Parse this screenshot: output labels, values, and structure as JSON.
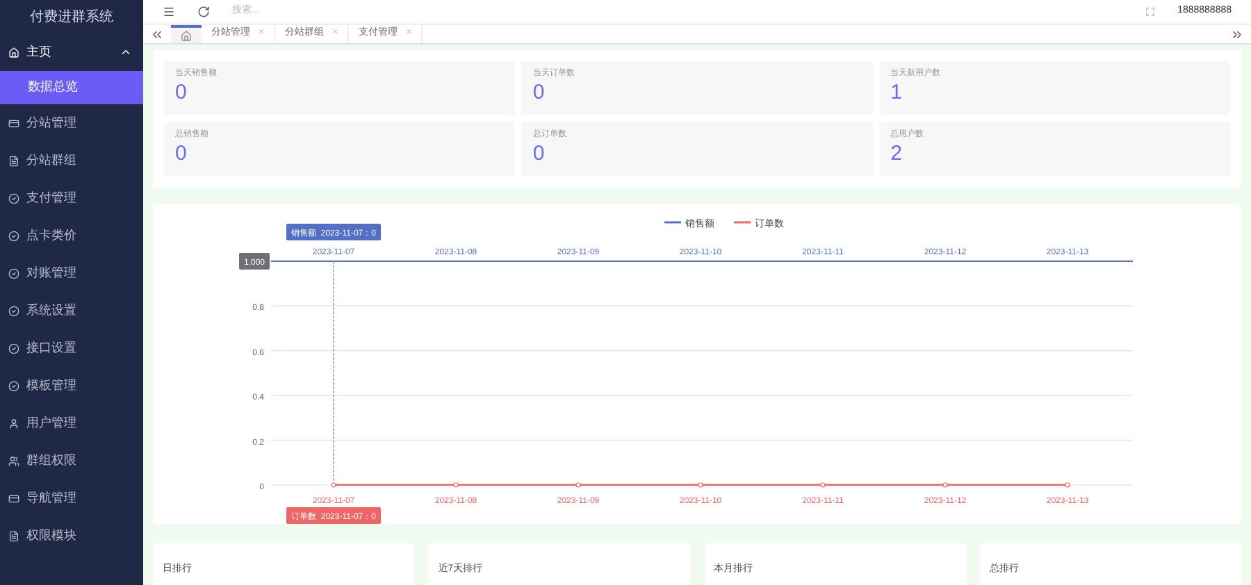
{
  "sidebar": {
    "title": "付费进群系统",
    "items": [
      {
        "label": "主页",
        "expanded": true,
        "children": [
          {
            "label": "数据总览",
            "selected": true
          }
        ]
      },
      {
        "label": "分站管理",
        "expanded": false
      },
      {
        "label": "分站群组",
        "expanded": false
      },
      {
        "label": "支付管理",
        "expanded": false
      },
      {
        "label": "点卡类价",
        "expanded": false
      },
      {
        "label": "对账管理",
        "expanded": false
      },
      {
        "label": "系统设置",
        "expanded": false
      },
      {
        "label": "接口设置",
        "expanded": false
      },
      {
        "label": "模板管理",
        "expanded": false
      },
      {
        "label": "用户管理",
        "expanded": false
      },
      {
        "label": "群组权限",
        "expanded": false
      },
      {
        "label": "导航管理",
        "expanded": false
      },
      {
        "label": "权限模块",
        "expanded": false
      }
    ]
  },
  "header": {
    "search": {
      "placeholder": "搜索..."
    },
    "user": "1888888888"
  },
  "tabs": [
    {
      "kind": "home",
      "selected": true
    },
    {
      "kind": "page",
      "label": "分站管理",
      "close": "×",
      "selected": false
    },
    {
      "kind": "page",
      "label": "分站群组",
      "close": "×",
      "selected": false
    },
    {
      "kind": "page",
      "label": "支付管理",
      "close": "×",
      "selected": false
    }
  ],
  "stats": [
    {
      "label": "当天销售额",
      "value": "0"
    },
    {
      "label": "当天订单数",
      "value": "0"
    },
    {
      "label": "当天新用户数",
      "value": "1"
    },
    {
      "label": "总销售额",
      "value": "0"
    },
    {
      "label": "总订单数",
      "value": "0"
    },
    {
      "label": "总用户数",
      "value": "2"
    }
  ],
  "chart": {
    "chart_data": {
      "type": "line",
      "categories": [
        "2023-11-07",
        "2023-11-08",
        "2023-11-09",
        "2023-11-10",
        "2023-11-11",
        "2023-11-12",
        "2023-11-13"
      ],
      "series": [
        {
          "name": "销售额",
          "color": "#5470c6",
          "values": [
            null,
            null,
            null,
            null,
            null,
            null,
            null
          ],
          "marker": true
        },
        {
          "name": "订单数",
          "color": "#ee6666",
          "values": [
            0,
            0,
            0,
            0,
            0,
            0,
            0
          ],
          "marker": true
        }
      ],
      "grid": true,
      "legend": "top",
      "ref_lines": [
        {
          "axis": "x",
          "value": "2023-11-07"
        }
      ],
      "ylim": [
        0,
        1
      ],
      "yticks": [
        0,
        0.2,
        0.4,
        0.6,
        0.8,
        {
          "value": 1,
          "label": "1.000"
        }
      ],
      "annotations": [
        "销售额  2023-11-07：0",
        "订单数  2023-11-07：0"
      ]
    }
  },
  "rankings": [
    {
      "title": "日排行"
    },
    {
      "title": "近7天排行"
    },
    {
      "title": "本月排行"
    },
    {
      "title": "总排行"
    }
  ]
}
